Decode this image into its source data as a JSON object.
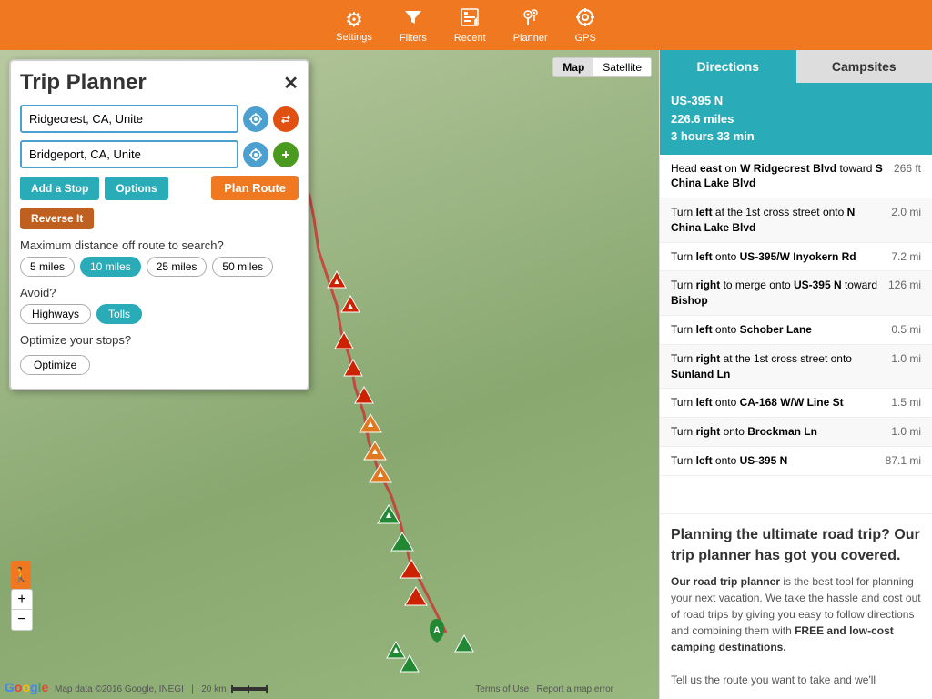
{
  "topbar": {
    "icons": [
      {
        "name": "settings-icon",
        "symbol": "⚙",
        "label": "Settings"
      },
      {
        "name": "filters-icon",
        "symbol": "▽",
        "label": "Filters"
      },
      {
        "name": "recent-icon",
        "symbol": "💾",
        "label": "Recent"
      },
      {
        "name": "planner-icon",
        "symbol": "📍",
        "label": "Planner"
      },
      {
        "name": "gps-icon",
        "symbol": "◎",
        "label": "GPS"
      }
    ]
  },
  "trip_panel": {
    "title": "Trip Planner",
    "close_label": "✕",
    "origin": "Ridgecrest, CA, Unite",
    "destination": "Bridgeport, CA, Unite",
    "add_stop_label": "Add a Stop",
    "options_label": "Options",
    "plan_route_label": "Plan Route",
    "reverse_label": "Reverse It",
    "max_distance_label": "Maximum distance off route to search?",
    "distances": [
      "5 miles",
      "10 miles",
      "25 miles",
      "50 miles"
    ],
    "active_distance": "10 miles",
    "avoid_label": "Avoid?",
    "avoid_options": [
      "Highways",
      "Tolls"
    ],
    "active_avoids": [
      "Tolls"
    ],
    "optimize_label": "Optimize your stops?",
    "optimize_btn": "Optimize"
  },
  "map": {
    "toggle_map": "Map",
    "toggle_satellite": "Satellite",
    "footer_data": "Map data ©2016 Google, INEGI",
    "scale": "20 km",
    "terms": "Terms of Use",
    "report": "Report a map error",
    "zoom_in": "+",
    "zoom_out": "−"
  },
  "right_panel": {
    "tab_directions": "Directions",
    "tab_campsites": "Campsites",
    "active_tab": "directions",
    "route_summary_line1": "US-395 N",
    "route_summary_line2": "226.6 miles",
    "route_summary_line3": "3 hours 33 min",
    "directions": [
      {
        "text": "Head <b>east</b> on <b>W Ridgecrest Blvd</b> toward <b>S China Lake Blvd</b>",
        "dist": "266 ft"
      },
      {
        "text": "Turn <b>left</b> at the 1st cross street onto <b>N China Lake Blvd</b>",
        "dist": "2.0 mi"
      },
      {
        "text": "Turn <b>left</b> onto <b>US-395/W Inyokern Rd</b>",
        "dist": "7.2 mi"
      },
      {
        "text": "Turn <b>right</b> to merge onto <b>US-395 N</b> toward <b>Bishop</b>",
        "dist": "126 mi"
      },
      {
        "text": "Turn <b>left</b> onto <b>Schober Lane</b>",
        "dist": "0.5 mi"
      },
      {
        "text": "Turn <b>right</b> at the 1st cross street onto <b>Sunland Ln</b>",
        "dist": "1.0 mi"
      },
      {
        "text": "Turn <b>left</b> onto <b>CA-168 W/W Line St</b>",
        "dist": "1.5 mi"
      },
      {
        "text": "Turn <b>right</b> onto <b>Brockman Ln</b>",
        "dist": "1.0 mi"
      },
      {
        "text": "Turn <b>left</b> onto <b>US-395 N</b>",
        "dist": "87.1 mi"
      }
    ],
    "promo_title": "Planning the ultimate road trip? Our trip planner has got you covered.",
    "promo_body_1": "Our road trip planner",
    "promo_body_2": " is the best tool for planning your next vacation. We take the hassle and cost out of road trips by giving you easy to follow directions and combining them with ",
    "promo_bold_2": "FREE and low-cost camping destinations.",
    "promo_body_3": "Tell us the route you want to take and we'll"
  }
}
